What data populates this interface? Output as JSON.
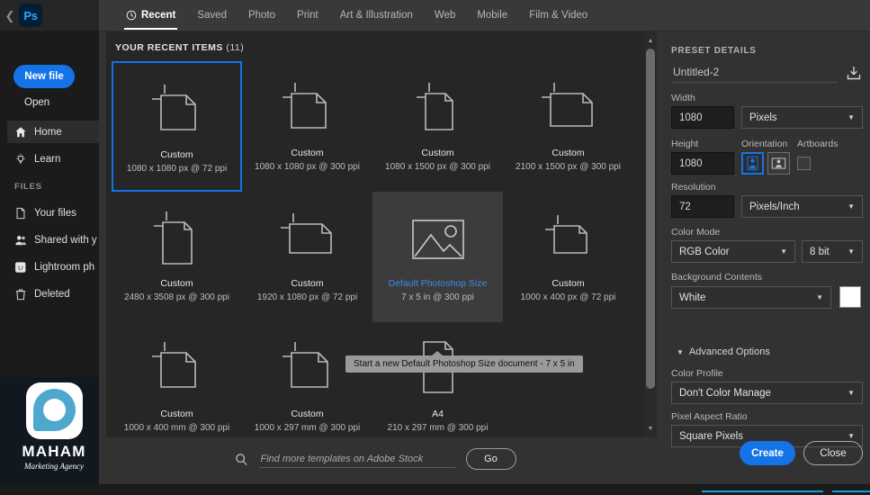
{
  "app": {
    "logo_text": "Ps",
    "back_icon": "chevron-left-icon"
  },
  "sidebar": {
    "new_file_label": "New file",
    "open_label": "Open",
    "section_files": "FILES",
    "items": [
      {
        "label": "Home",
        "icon": "home-icon",
        "active": true
      },
      {
        "label": "Learn",
        "icon": "lightbulb-icon",
        "active": false
      },
      {
        "label": "Your files",
        "icon": "file-icon",
        "active": false
      },
      {
        "label": "Shared with y",
        "icon": "people-icon",
        "active": false
      },
      {
        "label": "Lightroom ph",
        "icon": "lightroom-icon",
        "active": false
      },
      {
        "label": "Deleted",
        "icon": "trash-icon",
        "active": false
      }
    ],
    "branding": {
      "name": "MAHAM",
      "tagline": "Marketing Agency"
    }
  },
  "dialog": {
    "tabs": [
      {
        "label": "Recent",
        "icon": "clock-icon",
        "active": true
      },
      {
        "label": "Saved",
        "icon": "",
        "active": false
      },
      {
        "label": "Photo",
        "icon": "",
        "active": false
      },
      {
        "label": "Print",
        "icon": "",
        "active": false
      },
      {
        "label": "Art & Illustration",
        "icon": "",
        "active": false
      },
      {
        "label": "Web",
        "icon": "",
        "active": false
      },
      {
        "label": "Mobile",
        "icon": "",
        "active": false
      },
      {
        "label": "Film & Video",
        "icon": "",
        "active": false
      }
    ],
    "recent_header": "YOUR RECENT ITEMS",
    "recent_count": "(11)",
    "items": [
      {
        "name": "Custom",
        "dimensions": "1080 x 1080 px @ 72 ppi",
        "thumb": "doc-portrait-icon",
        "state": "selected"
      },
      {
        "name": "Custom",
        "dimensions": "1080 x 1080 px @ 300 ppi",
        "thumb": "doc-portrait-icon",
        "state": "normal"
      },
      {
        "name": "Custom",
        "dimensions": "1080 x 1500 px @ 300 ppi",
        "thumb": "doc-tall-icon",
        "state": "normal"
      },
      {
        "name": "Custom",
        "dimensions": "2100 x 1500 px @ 300 ppi",
        "thumb": "doc-wide-icon",
        "state": "normal"
      },
      {
        "name": "Custom",
        "dimensions": "2480 x 3508 px @ 300 ppi",
        "thumb": "doc-tall-icon",
        "state": "normal"
      },
      {
        "name": "Custom",
        "dimensions": "1920 x 1080 px @ 72 ppi",
        "thumb": "doc-wide-icon",
        "state": "normal"
      },
      {
        "name": "Default Photoshop Size",
        "dimensions": "7 x 5 in @ 300 ppi",
        "thumb": "photo-icon",
        "state": "hovered"
      },
      {
        "name": "Custom",
        "dimensions": "1000 x 400 px @ 72 ppi",
        "thumb": "doc-wide-icon",
        "state": "normal"
      },
      {
        "name": "Custom",
        "dimensions": "1000 x 400 mm @ 300 ppi",
        "thumb": "doc-portrait-icon",
        "state": "normal"
      },
      {
        "name": "Custom",
        "dimensions": "1000 x 297 mm @ 300 ppi",
        "thumb": "doc-wide-icon",
        "state": "normal"
      },
      {
        "name": "A4",
        "dimensions": "210 x 297 mm @ 300 ppi",
        "thumb": "doc-a4-icon",
        "state": "normal"
      }
    ],
    "tooltip": "Start a new Default Photoshop Size document - 7 x 5 in",
    "search": {
      "placeholder": "Find more templates on Adobe Stock",
      "value": "",
      "go_label": "Go",
      "icon": "search-icon"
    }
  },
  "preset": {
    "title": "PRESET DETAILS",
    "doc_name": "Untitled-2",
    "save_preset_icon": "save-preset-icon",
    "width": {
      "label": "Width",
      "value": "1080",
      "unit": "Pixels"
    },
    "height": {
      "label": "Height",
      "value": "1080"
    },
    "orientation": {
      "label": "Orientation",
      "portrait_selected": true
    },
    "artboards": {
      "label": "Artboards",
      "checked": false
    },
    "resolution": {
      "label": "Resolution",
      "value": "72",
      "unit": "Pixels/Inch"
    },
    "color_mode": {
      "label": "Color Mode",
      "value": "RGB Color",
      "depth": "8 bit"
    },
    "background": {
      "label": "Background Contents",
      "value": "White",
      "swatch_color": "#ffffff"
    },
    "advanced_label": "Advanced Options",
    "color_profile": {
      "label": "Color Profile",
      "value": "Don't Color Manage"
    },
    "pixel_aspect": {
      "label": "Pixel Aspect Ratio",
      "value": "Square Pixels"
    },
    "create_label": "Create",
    "close_label": "Close"
  },
  "colors": {
    "accent_blue": "#1473e6",
    "panel_bg": "#323232",
    "content_bg": "#262626",
    "brand_teal": "#4ea8ce"
  }
}
